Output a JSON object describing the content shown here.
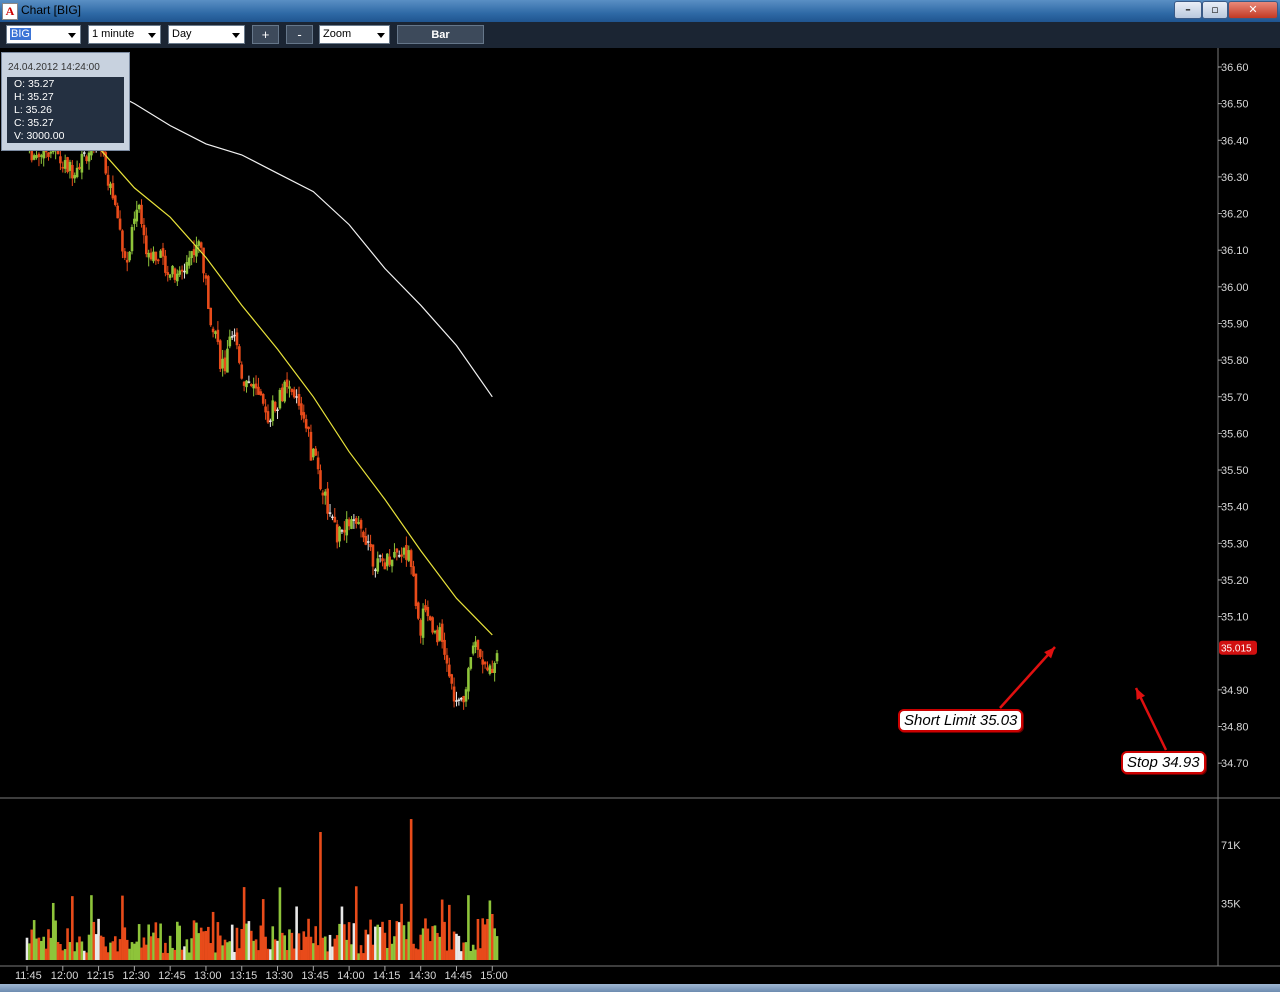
{
  "window": {
    "title": "Chart [BIG]",
    "app_icon_letter": "A",
    "minimize": "–",
    "maximize": "▫",
    "close": "✕"
  },
  "toolbar": {
    "symbol": "BIG",
    "interval": "1 minute",
    "range": "Day",
    "zoom_in": "+",
    "zoom_out": "-",
    "zoom_mode": "Zoom",
    "chart_type": "Bar"
  },
  "info": {
    "datetime": "24.04.2012 14:24:00",
    "open": "O: 35.27",
    "high": "H: 35.27",
    "low": "L: 35.26",
    "close": "C: 35.27",
    "volume": "V: 3000.00"
  },
  "annotations": {
    "short_limit": "Short Limit 35.03",
    "stop": "Stop 34.93"
  },
  "colors": {
    "up": "#8ec43a",
    "down": "#e84b1a",
    "neutral": "#e8e8e8",
    "ma_fast": "#e8e23a",
    "ma_slow": "#f2f2f2",
    "price_tag": "#d11010",
    "arrow": "#e01010"
  },
  "chart_data": {
    "type": "candlestick",
    "price_axis": {
      "ylim": [
        34.61,
        36.64
      ],
      "ticks": [
        "36.60",
        "36.50",
        "36.40",
        "36.30",
        "36.20",
        "36.10",
        "36.00",
        "35.90",
        "35.80",
        "35.70",
        "35.60",
        "35.50",
        "35.40",
        "35.30",
        "35.20",
        "35.10",
        "34.90",
        "34.80",
        "34.70"
      ],
      "last_price_label": "35.015",
      "last_price": 35.015
    },
    "volume_axis": {
      "ticks": [
        "71K",
        "35K"
      ],
      "ylim": [
        0,
        100000
      ]
    },
    "time_axis": {
      "labels": [
        "11:45",
        "12:00",
        "12:15",
        "12:30",
        "12:45",
        "13:00",
        "13:15",
        "13:30",
        "13:45",
        "14:00",
        "14:15",
        "14:30",
        "14:45",
        "15:00"
      ]
    },
    "price_path": [
      [
        "11:45",
        36.38
      ],
      [
        "11:48",
        36.36
      ],
      [
        "11:52",
        36.37
      ],
      [
        "11:56",
        36.38
      ],
      [
        "12:00",
        36.33
      ],
      [
        "12:04",
        36.32
      ],
      [
        "12:08",
        36.35
      ],
      [
        "12:12",
        36.38
      ],
      [
        "12:16",
        36.38
      ],
      [
        "12:19",
        36.3
      ],
      [
        "12:22",
        36.22
      ],
      [
        "12:25",
        36.12
      ],
      [
        "12:27",
        36.06
      ],
      [
        "12:30",
        36.18
      ],
      [
        "12:32",
        36.22
      ],
      [
        "12:34",
        36.12
      ],
      [
        "12:36",
        36.1
      ],
      [
        "12:40",
        36.09
      ],
      [
        "12:44",
        36.05
      ],
      [
        "12:48",
        36.02
      ],
      [
        "12:52",
        36.07
      ],
      [
        "12:56",
        36.12
      ],
      [
        "12:58",
        36.1
      ],
      [
        "13:00",
        36.0
      ],
      [
        "13:02",
        35.92
      ],
      [
        "13:04",
        35.88
      ],
      [
        "13:06",
        35.8
      ],
      [
        "13:08",
        35.78
      ],
      [
        "13:10",
        35.84
      ],
      [
        "13:13",
        35.86
      ],
      [
        "13:15",
        35.75
      ],
      [
        "13:18",
        35.74
      ],
      [
        "13:21",
        35.71
      ],
      [
        "13:23",
        35.68
      ],
      [
        "13:25",
        35.64
      ],
      [
        "13:27",
        35.66
      ],
      [
        "13:29",
        35.68
      ],
      [
        "13:31",
        35.7
      ],
      [
        "13:33",
        35.72
      ],
      [
        "13:36",
        35.7
      ],
      [
        "13:38",
        35.69
      ],
      [
        "13:40",
        35.66
      ],
      [
        "13:42",
        35.63
      ],
      [
        "13:44",
        35.55
      ],
      [
        "13:46",
        35.54
      ],
      [
        "13:48",
        35.46
      ],
      [
        "13:50",
        35.43
      ],
      [
        "13:52",
        35.37
      ],
      [
        "13:55",
        35.32
      ],
      [
        "13:58",
        35.33
      ],
      [
        "14:00",
        35.36
      ],
      [
        "14:03",
        35.34
      ],
      [
        "14:06",
        35.33
      ],
      [
        "14:08",
        35.31
      ],
      [
        "14:10",
        35.26
      ],
      [
        "14:12",
        35.24
      ],
      [
        "14:15",
        35.25
      ],
      [
        "14:18",
        35.27
      ],
      [
        "14:21",
        35.28
      ],
      [
        "14:24",
        35.27
      ],
      [
        "14:26",
        35.26
      ],
      [
        "14:28",
        35.14
      ],
      [
        "14:30",
        35.07
      ],
      [
        "14:32",
        35.13
      ],
      [
        "14:34",
        35.09
      ],
      [
        "14:36",
        35.06
      ],
      [
        "14:38",
        35.05
      ],
      [
        "14:40",
        35.0
      ],
      [
        "14:42",
        34.93
      ],
      [
        "14:44",
        34.88
      ],
      [
        "14:46",
        34.85
      ],
      [
        "14:48",
        34.87
      ],
      [
        "14:50",
        34.97
      ],
      [
        "14:52",
        35.02
      ],
      [
        "14:54",
        35.03
      ],
      [
        "14:56",
        34.98
      ],
      [
        "14:58",
        34.94
      ],
      [
        "15:00",
        34.96
      ],
      [
        "15:02",
        35.01
      ]
    ],
    "volume_spikes": [
      [
        "12:12",
        40000
      ],
      [
        "13:16",
        45000
      ],
      [
        "13:48",
        79000
      ],
      [
        "14:26",
        87000
      ],
      [
        "14:50",
        40000
      ]
    ],
    "ma_fast": [
      [
        "11:45",
        36.49
      ],
      [
        "12:00",
        36.46
      ],
      [
        "12:15",
        36.38
      ],
      [
        "12:30",
        36.27
      ],
      [
        "12:45",
        36.19
      ],
      [
        "13:00",
        36.08
      ],
      [
        "13:15",
        35.95
      ],
      [
        "13:30",
        35.83
      ],
      [
        "13:45",
        35.7
      ],
      [
        "14:00",
        35.55
      ],
      [
        "14:15",
        35.42
      ],
      [
        "14:30",
        35.28
      ],
      [
        "14:45",
        35.15
      ],
      [
        "15:00",
        35.05
      ]
    ],
    "ma_slow": [
      [
        "12:03",
        36.62
      ],
      [
        "12:15",
        36.55
      ],
      [
        "12:30",
        36.5
      ],
      [
        "12:45",
        36.44
      ],
      [
        "13:00",
        36.39
      ],
      [
        "13:15",
        36.36
      ],
      [
        "13:30",
        36.31
      ],
      [
        "13:45",
        36.26
      ],
      [
        "14:00",
        36.17
      ],
      [
        "14:15",
        36.05
      ],
      [
        "14:30",
        35.95
      ],
      [
        "14:45",
        35.84
      ],
      [
        "15:00",
        35.7
      ]
    ]
  }
}
